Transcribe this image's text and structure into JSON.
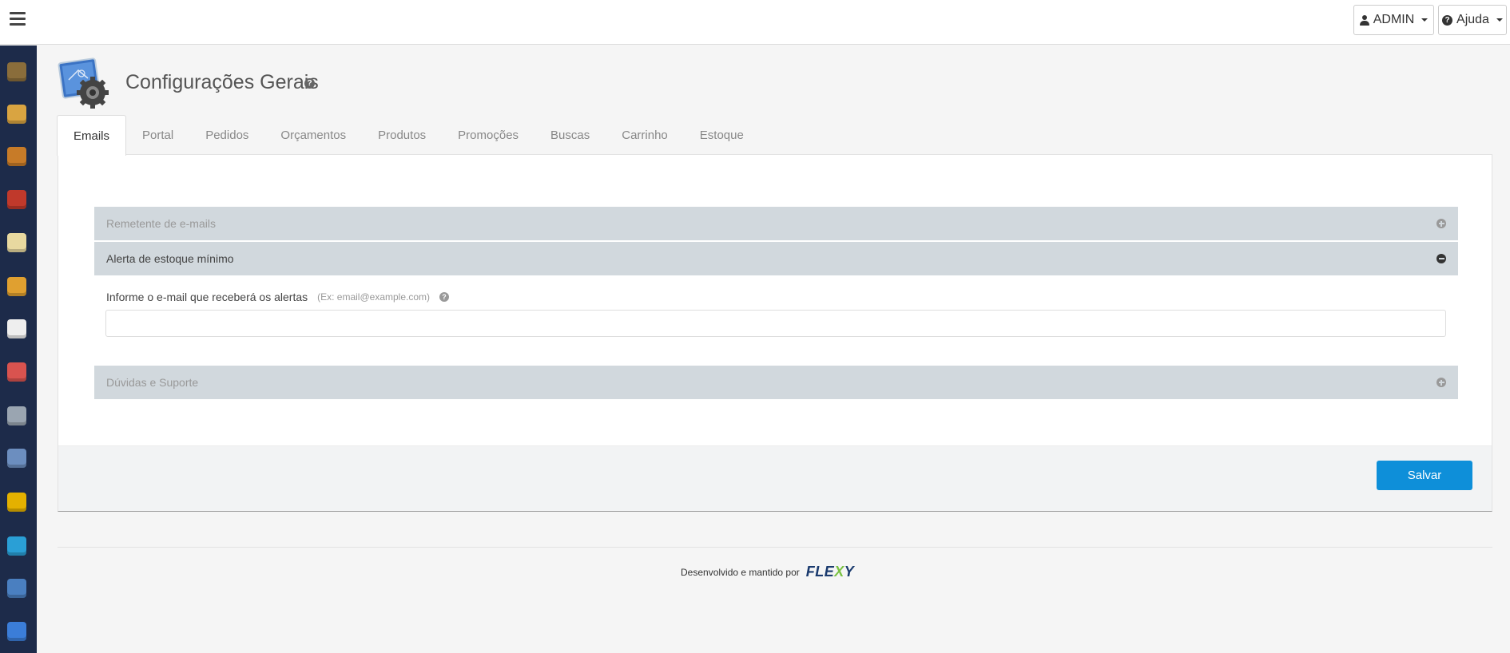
{
  "topbar": {
    "user_label": "ADMIN",
    "help_label": "Ajuda"
  },
  "sidebar": {
    "items": [
      {
        "icon": "box-icon",
        "color": "#8a6d3b"
      },
      {
        "icon": "document-icon",
        "color": "#d9a441"
      },
      {
        "icon": "stack-icon",
        "color": "#c77b28"
      },
      {
        "icon": "discount-icon",
        "color": "#c0392b"
      },
      {
        "icon": "card-icon",
        "color": "#e8d9a0"
      },
      {
        "icon": "truck-icon",
        "color": "#e0a030"
      },
      {
        "icon": "note-icon",
        "color": "#eeeeee"
      },
      {
        "icon": "users-icon",
        "color": "#d9534f"
      },
      {
        "icon": "person-icon",
        "color": "#9aa5b1"
      },
      {
        "icon": "printer-icon",
        "color": "#6c8ebf"
      },
      {
        "icon": "chart-icon",
        "color": "#e4b100"
      },
      {
        "icon": "share-icon",
        "color": "#2a9fd6"
      },
      {
        "icon": "settings-icon",
        "color": "#4a7fc0"
      },
      {
        "icon": "help-book-icon",
        "color": "#3b7dd8"
      }
    ]
  },
  "page": {
    "title": "Configurações Gerais",
    "help_icon": "?"
  },
  "tabs": [
    "Emails",
    "Portal",
    "Pedidos",
    "Orçamentos",
    "Produtos",
    "Promoções",
    "Buscas",
    "Carrinho",
    "Estoque"
  ],
  "accordion": {
    "section1": "Remetente de e-mails",
    "section2": "Alerta de estoque mínimo",
    "section3": "Dúvidas e Suporte"
  },
  "form": {
    "email_label": "Informe o e-mail que receberá os alertas",
    "email_hint": "(Ex: email@example.com)",
    "email_value": ""
  },
  "actions": {
    "save_label": "Salvar"
  },
  "footer": {
    "text": "Desenvolvido e mantido por",
    "brand_a": "FLE",
    "brand_x": "X",
    "brand_b": "Y"
  },
  "colors": {
    "sidebar_bg": "#1d2b4a",
    "accordion_bg": "#d1d8dd",
    "primary": "#0e8fd9"
  }
}
